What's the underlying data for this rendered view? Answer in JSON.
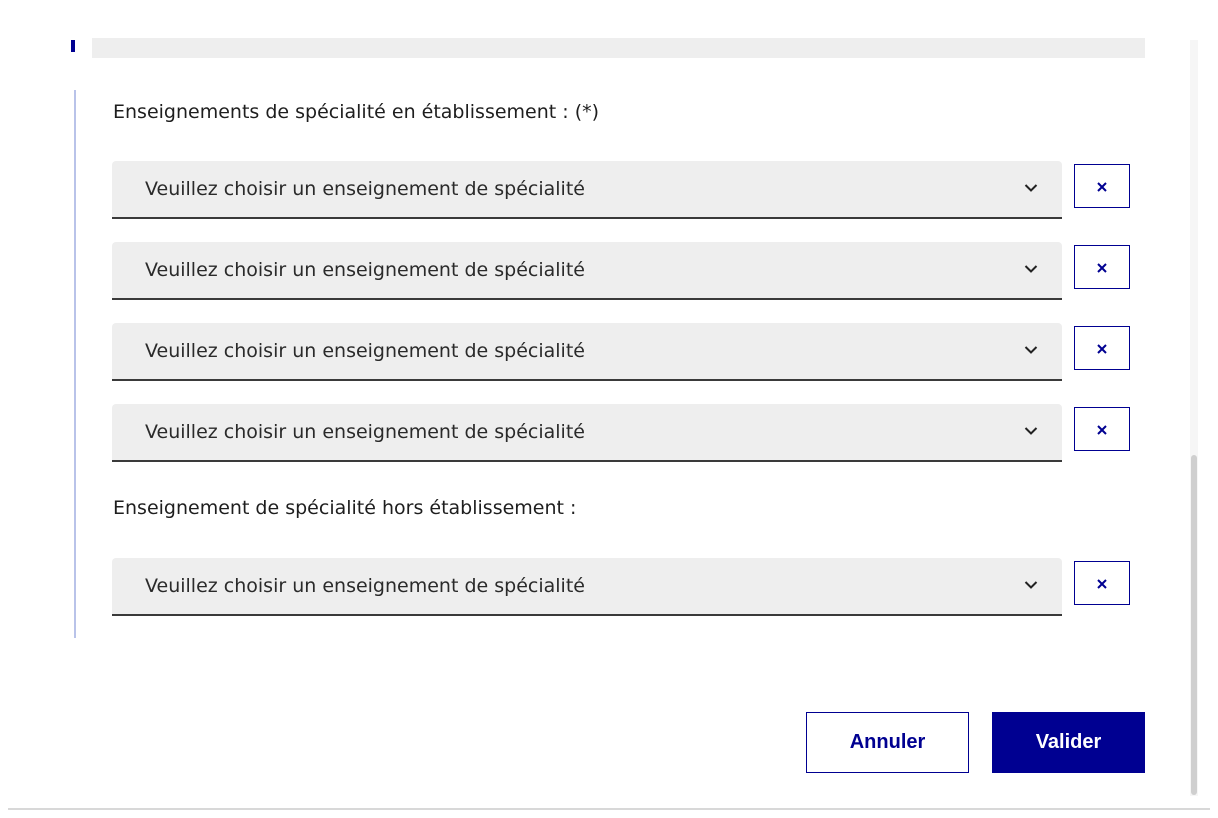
{
  "form": {
    "label_in_school": "Enseignements de spécialité en établissement : (*)",
    "label_outside_school": "Enseignement de spécialité hors établissement :",
    "select_placeholder": "Veuillez choisir un enseignement de spécialité",
    "selects_in_school": [
      {
        "value": "Veuillez choisir un enseignement de spécialité"
      },
      {
        "value": "Veuillez choisir un enseignement de spécialité"
      },
      {
        "value": "Veuillez choisir un enseignement de spécialité"
      },
      {
        "value": "Veuillez choisir un enseignement de spécialité"
      }
    ],
    "select_outside_school": {
      "value": "Veuillez choisir un enseignement de spécialité"
    },
    "remove_icon": "close-icon",
    "dropdown_icon": "chevron-down-icon"
  },
  "actions": {
    "cancel_label": "Annuler",
    "validate_label": "Valider"
  },
  "colors": {
    "primary": "#000091",
    "field_background": "#eeeeee",
    "field_border": "#3a3a3a",
    "accent_line": "#b9c3e9"
  }
}
